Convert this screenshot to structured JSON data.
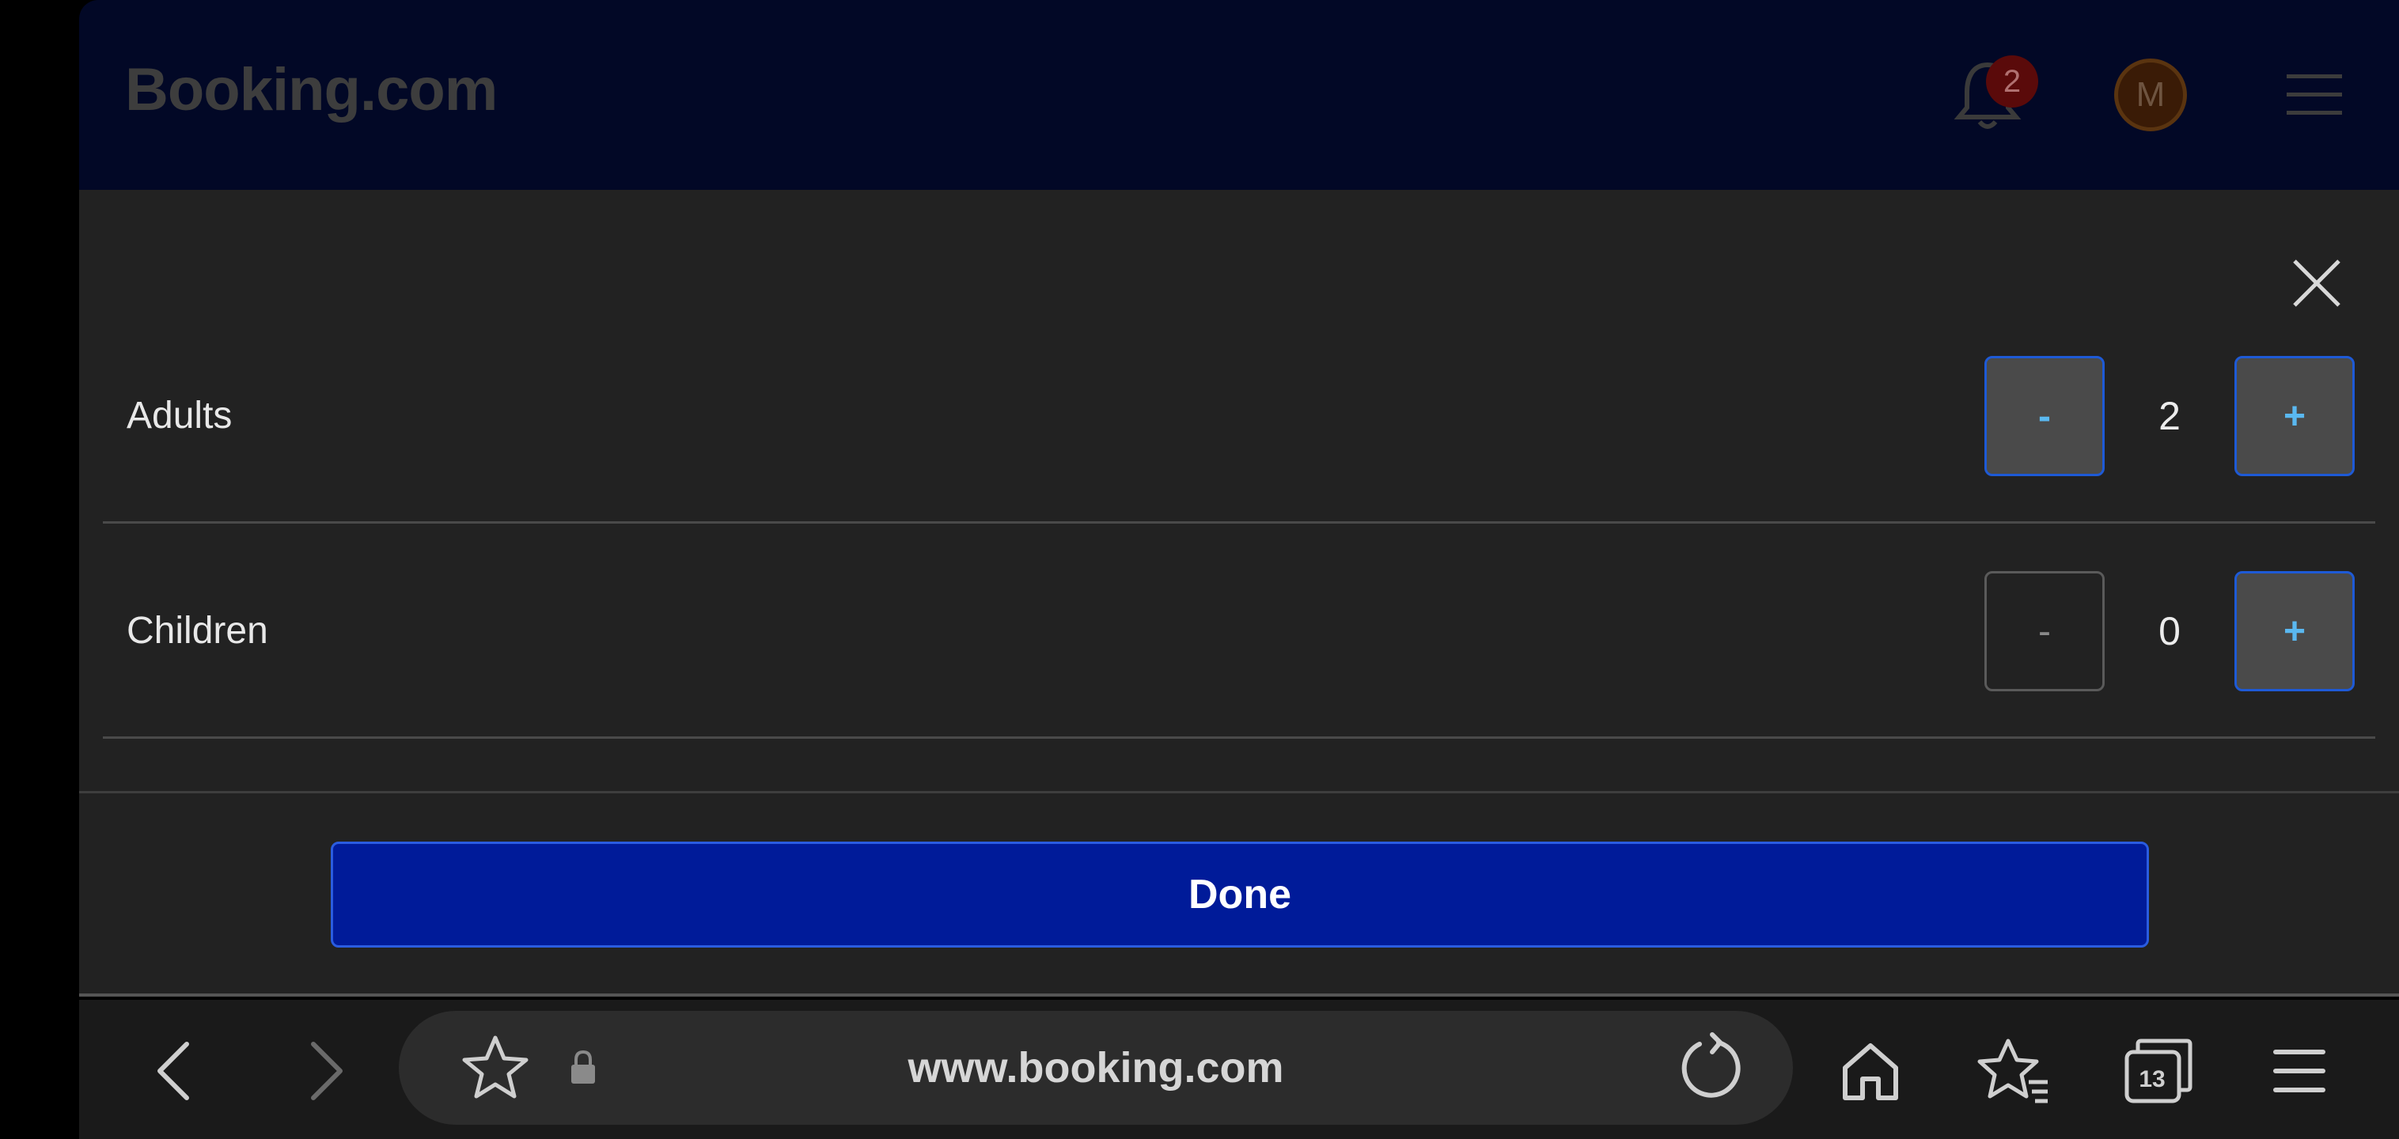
{
  "header": {
    "logo_text": "Booking.com",
    "notification_count": "2",
    "avatar_initial": "M"
  },
  "guests": {
    "rows": [
      {
        "label": "Adults",
        "value": "2",
        "minus_label": "-",
        "plus_label": "+",
        "minus_enabled": true
      },
      {
        "label": "Children",
        "value": "0",
        "minus_label": "-",
        "plus_label": "+",
        "minus_enabled": false
      }
    ],
    "done_label": "Done"
  },
  "browser": {
    "url": "www.booking.com",
    "tab_count": "13"
  },
  "colors": {
    "done_button": "#001b99",
    "stepper_border": "#1e5ad6",
    "stepper_text": "#5ab8f0",
    "modal_bg": "#222222"
  }
}
